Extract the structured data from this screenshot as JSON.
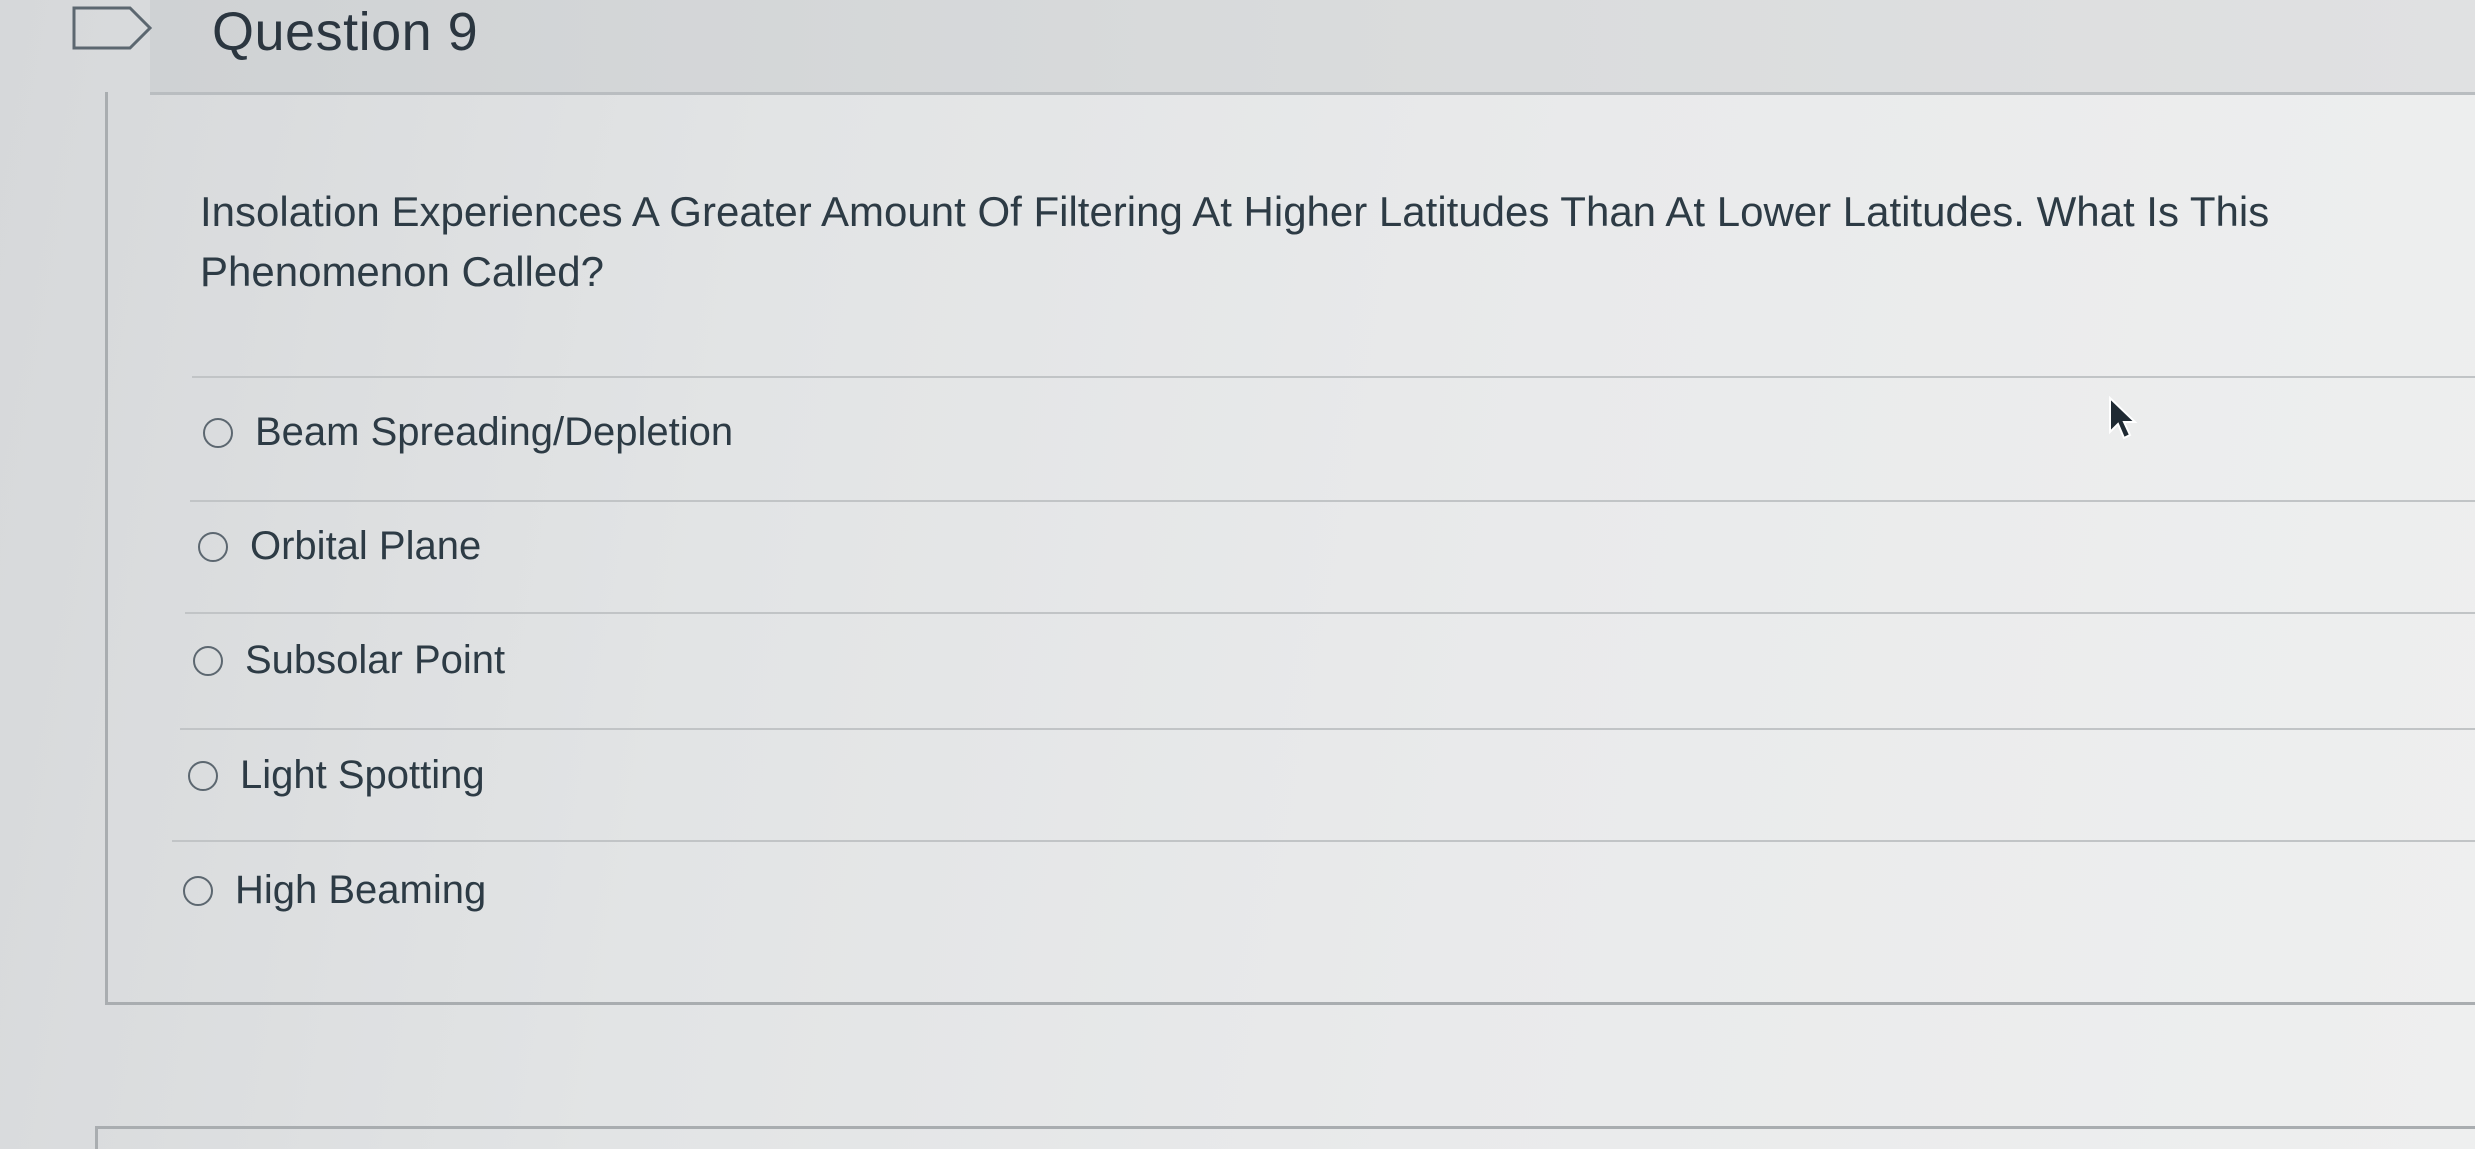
{
  "question": {
    "title": "Question 9",
    "text": "Insolation Experiences A Greater Amount Of Filtering At Higher Latitudes Than At Lower Latitudes. What Is This Phenomenon Called?"
  },
  "answers": [
    {
      "label": "Beam Spreading/Depletion",
      "selected": false
    },
    {
      "label": "Orbital Plane",
      "selected": false
    },
    {
      "label": "Subsolar Point",
      "selected": false
    },
    {
      "label": "Light Spotting",
      "selected": false
    },
    {
      "label": "High Beaming",
      "selected": false
    }
  ],
  "icons": {
    "flag": "flag-icon",
    "cursor": "mouse-pointer-icon",
    "radio": "radio-unchecked-icon"
  },
  "colors": {
    "text": "#2d3b45",
    "border": "#a9adb0",
    "divider": "#c1c4c6"
  }
}
